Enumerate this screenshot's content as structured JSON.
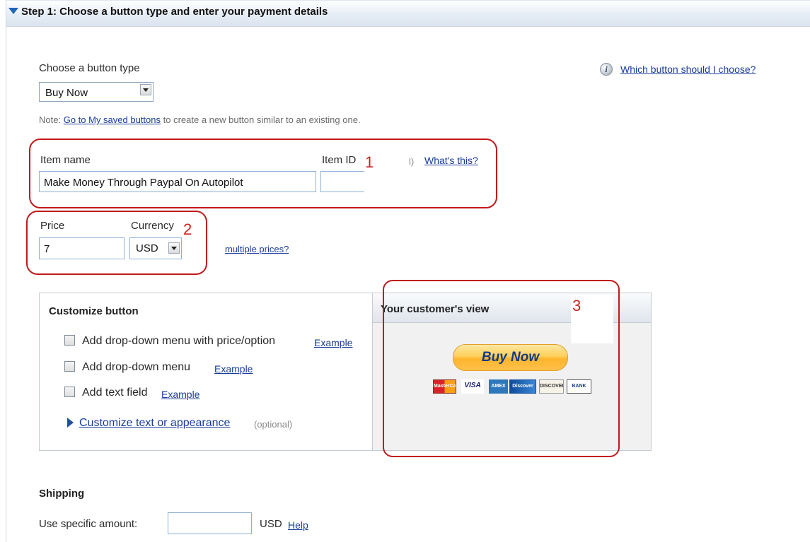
{
  "step": {
    "title": "Step 1: Choose a button type and enter your payment details"
  },
  "help": {
    "which_button": "Which button should I choose?"
  },
  "button_type": {
    "label": "Choose a button type",
    "selected": "Buy Now"
  },
  "note": {
    "prefix": "Note:",
    "link": "Go to My saved buttons",
    "suffix": "to create a new button similar to an existing one."
  },
  "item": {
    "name_label": "Item name",
    "name_value": "Make Money Through Paypal On Autopilot",
    "id_label": "Item ID",
    "paren": "l)",
    "whats_this": "What's this?"
  },
  "price": {
    "price_label": "Price",
    "price_value": "7",
    "currency_label": "Currency",
    "currency_value": "USD",
    "multiple": "multiple prices?"
  },
  "annotations": {
    "n1": "1",
    "n2": "2",
    "n3": "3"
  },
  "customize": {
    "heading": "Customize button",
    "options": [
      {
        "label": "Add drop-down menu with price/option",
        "example": "Example"
      },
      {
        "label": "Add drop-down menu",
        "example": "Example"
      },
      {
        "label": "Add text field",
        "example": "Example"
      }
    ],
    "appearance_link": "Customize text or appearance",
    "optional": "(optional)"
  },
  "preview": {
    "heading": "Your customer's view",
    "button": "Buy Now",
    "cards": [
      "MasterCard",
      "VISA",
      "AMEX",
      "Discover",
      "DISCOVER",
      "BANK"
    ]
  },
  "shipping": {
    "heading": "Shipping",
    "label": "Use specific amount:",
    "currency": "USD",
    "help": "Help"
  },
  "colors": {
    "annotation_red": "#c2191c",
    "link_blue": "#1a3d9c",
    "accent_blue": "#1e67b8"
  }
}
